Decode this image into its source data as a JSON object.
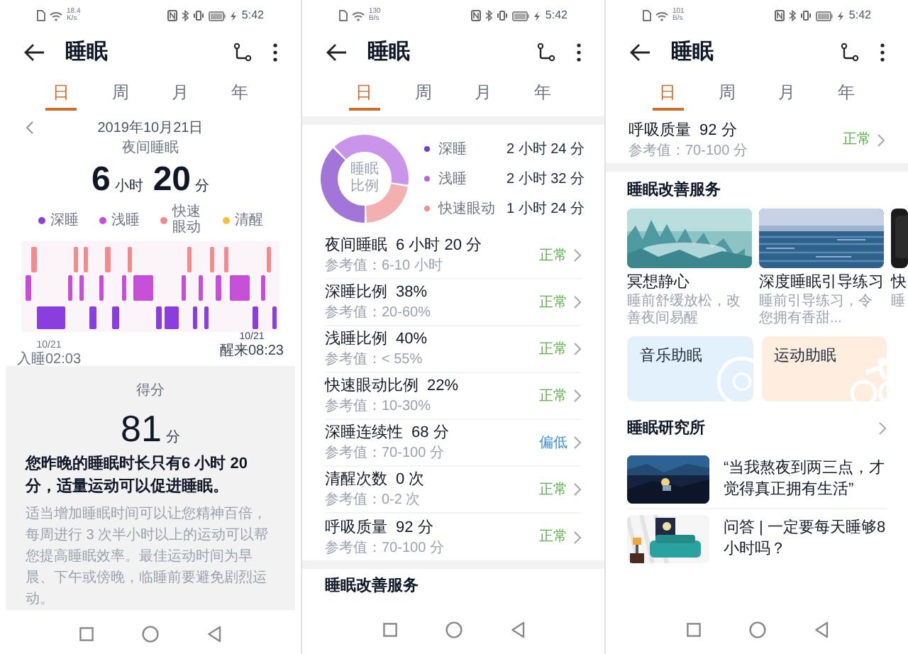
{
  "screens": [
    {
      "kind": "overview",
      "status_bar": {
        "speed": "18.4",
        "unit": "K/s",
        "time": "5:42"
      },
      "title": "睡眠",
      "tabs": [
        {
          "label": "日",
          "selected": true
        },
        {
          "label": "周",
          "selected": false
        },
        {
          "label": "月",
          "selected": false
        },
        {
          "label": "年",
          "selected": false
        }
      ],
      "date": "2019年10月21日",
      "subtitle": "夜间睡眠",
      "duration": {
        "hours": "6",
        "hours_unit": "小时",
        "minutes": "20",
        "minutes_unit": "分"
      },
      "legend": [
        {
          "label": "深睡",
          "color": "#8a3ee0"
        },
        {
          "label": "浅睡",
          "color": "#c54fd6"
        },
        {
          "label": "快速眼动",
          "color": "#f08c8c"
        },
        {
          "label": "清醒",
          "color": "#f2c23c"
        }
      ],
      "start": {
        "date": "10/21",
        "label": "入睡02:03"
      },
      "end": {
        "date": "10/21",
        "label": "醒来08:23"
      },
      "score": {
        "label": "得分",
        "value": "81",
        "unit": "分"
      },
      "summary": "您昨晚的睡眠时长只有6 小时 20 分，适量运动可以促进睡眠。",
      "advice": "适当增加睡眠时间可以让您精神百倍，每周进行 3 次半小时以上的运动可以帮您提高睡眠效率。最佳运动时间为早晨、下午或傍晚，临睡前要避免剧烈运动。"
    },
    {
      "kind": "details",
      "status_bar": {
        "speed": "130",
        "unit": "B/s",
        "time": "5:42"
      },
      "title": "睡眠",
      "tabs": [
        {
          "label": "日",
          "selected": true
        },
        {
          "label": "周",
          "selected": false
        },
        {
          "label": "月",
          "selected": false
        },
        {
          "label": "年",
          "selected": false
        }
      ],
      "chart_data": {
        "type": "donut",
        "title": "睡眠比例",
        "values": [
          38,
          40,
          22
        ]
      },
      "legend": [
        {
          "label": "深睡",
          "value": "2 小时 24 分",
          "color": "#7a3cc8"
        },
        {
          "label": "浅睡",
          "value": "2 小时 32 分",
          "color": "#b266e0"
        },
        {
          "label": "快速眼动",
          "value": "1 小时 24 分",
          "color": "#f08f8f"
        }
      ],
      "metrics": [
        {
          "name": "夜间睡眠",
          "value": "6 小时 20 分",
          "reference": "参考值：6-10 小时",
          "status": "正常",
          "kind": "normal"
        },
        {
          "name": "深睡比例",
          "value": "38%",
          "reference": "参考值：20-60%",
          "status": "正常",
          "kind": "normal"
        },
        {
          "name": "浅睡比例",
          "value": "40%",
          "reference": "参考值：< 55%",
          "status": "正常",
          "kind": "normal"
        },
        {
          "name": "快速眼动比例",
          "value": "22%",
          "reference": "参考值：10-30%",
          "status": "正常",
          "kind": "normal"
        },
        {
          "name": "深睡连续性",
          "value": "68 分",
          "reference": "参考值：70-100 分",
          "status": "偏低",
          "kind": "low"
        },
        {
          "name": "清醒次数",
          "value": "0 次",
          "reference": "参考值：0-2 次",
          "status": "正常",
          "kind": "normal"
        },
        {
          "name": "呼吸质量",
          "value": "92 分",
          "reference": "参考值：70-100 分",
          "status": "正常",
          "kind": "normal"
        }
      ],
      "section_title": "睡眠改善服务"
    },
    {
      "kind": "services",
      "status_bar": {
        "speed": "101",
        "unit": "B/s",
        "time": "5:42"
      },
      "title": "睡眠",
      "tabs": [
        {
          "label": "日",
          "selected": true
        },
        {
          "label": "周",
          "selected": false
        },
        {
          "label": "月",
          "selected": false
        },
        {
          "label": "年",
          "selected": false
        }
      ],
      "metrics": [
        {
          "name": "呼吸质量",
          "value": "92 分",
          "reference": "参考值：70-100 分",
          "status": "正常",
          "kind": "normal"
        }
      ],
      "section_title": "睡眠改善服务",
      "services": [
        {
          "title": "冥想静心",
          "subtitle": "睡前舒缓放松，改善夜间易醒"
        },
        {
          "title": "深度睡眠引导练习",
          "subtitle": "睡前引导练习，令您拥有香甜..."
        },
        {
          "title": "快",
          "subtitle": "睡"
        }
      ],
      "aids": [
        {
          "title": "音乐助眠",
          "kind": "music",
          "color": "#e3f1fc"
        },
        {
          "title": "运动助眠",
          "kind": "exercise",
          "color": "#fdeee0"
        }
      ],
      "research_title": "睡眠研究所",
      "articles": [
        {
          "title": "“当我熬夜到两三点，才觉得真正拥有生活”"
        },
        {
          "title": "问答 | 一定要每天睡够8小时吗？"
        }
      ]
    }
  ]
}
